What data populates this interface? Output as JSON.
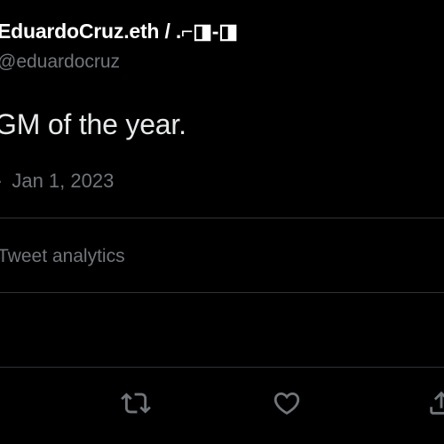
{
  "user": {
    "display_name": "EduardoCruz.eth / .⌐◨-◨",
    "handle": "@eduardocruz"
  },
  "tweet": {
    "text": "GM of the year.",
    "meta_prefix": "·",
    "date": "Jan 1, 2023"
  },
  "analytics": {
    "label": "Tweet analytics"
  },
  "actions": {
    "icons": [
      "retweet-icon",
      "like-icon",
      "share-icon"
    ]
  },
  "colors": {
    "background": "#000000",
    "primary_text": "#e7e9ea",
    "secondary_text": "#71767b",
    "divider": "#2f3336"
  }
}
